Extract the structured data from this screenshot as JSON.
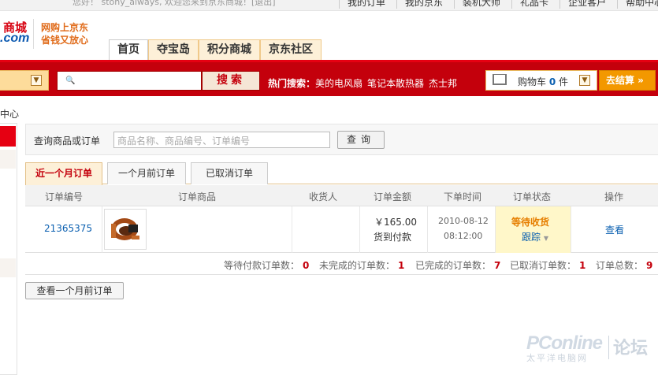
{
  "topbar": {
    "welcome": "您好！ stony_always, 欢迎您来到京东商城！[退出]",
    "links": [
      "我的订单",
      "我的京东",
      "装机大师",
      "礼品卡",
      "企业客户",
      "帮助中心"
    ]
  },
  "logo": {
    "line1": "商城",
    "line2": ".com"
  },
  "slogan": {
    "line1": "网购上京东",
    "line2": "省钱又放心"
  },
  "nav_tabs": [
    "首页",
    "夺宝岛",
    "积分商城",
    "京东社区"
  ],
  "search": {
    "button": "搜索",
    "hot_label": "热门搜索：",
    "hot_keywords": [
      "美的电风扇",
      "笔记本散热器",
      "杰士邦"
    ]
  },
  "cart": {
    "label": "购物车",
    "count": "0",
    "unit": "件",
    "checkout": "去结算 »"
  },
  "sidebar": {
    "breadcrumb": "中心"
  },
  "query": {
    "label": "查询商品或订单",
    "placeholder": "商品名称、商品编号、订单编号",
    "button": "查询"
  },
  "order_tabs": [
    "近一个月订单",
    "一个月前订单",
    "已取消订单"
  ],
  "table": {
    "headers": [
      "订单编号",
      "订单商品",
      "收货人",
      "订单金额",
      "下单时间",
      "订单状态",
      "操作"
    ],
    "rows": [
      {
        "order_id": "21365375",
        "recipient": "",
        "amount": "￥165.00",
        "payment": "货到付款",
        "date": "2010-08-12",
        "time": "08:12:00",
        "status": "等待收货",
        "track": "跟踪",
        "action": "查看"
      }
    ]
  },
  "summary": [
    {
      "label": "等待付款订单数：",
      "value": "0"
    },
    {
      "label": "未完成的订单数：",
      "value": "1"
    },
    {
      "label": "已完成的订单数：",
      "value": "7"
    },
    {
      "label": "已取消订单数：",
      "value": "1"
    },
    {
      "label": "订单总数：",
      "value": "9"
    }
  ],
  "older_button": "查看一个月前订单",
  "watermark": {
    "brand": "PConline",
    "sub": "太平洋电脑网",
    "forum": "论坛"
  },
  "colors": {
    "brand_red": "#c4000c",
    "accent_orange": "#f39800",
    "status_bg": "#fff7c9",
    "link_blue": "#0a5fb0"
  }
}
